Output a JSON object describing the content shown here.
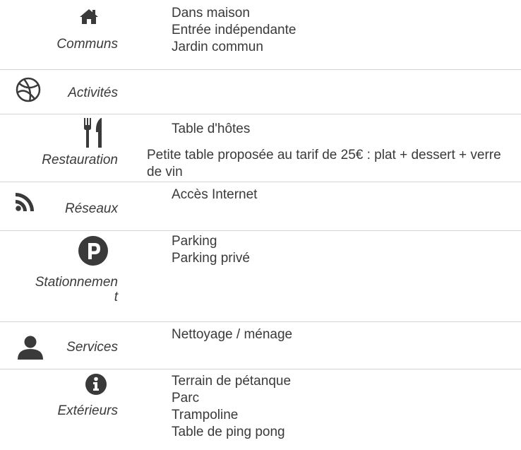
{
  "sections": [
    {
      "label": "Communs",
      "icon": "home-icon",
      "items": [
        "Dans maison",
        "Entrée indépendante",
        "Jardin commun"
      ]
    },
    {
      "label": "Activités",
      "icon": "basketball-icon",
      "items": []
    },
    {
      "label": "Restauration",
      "icon": "utensils-icon",
      "items": [
        "Table d'hôtes"
      ],
      "description": "Petite table proposée au tarif de 25€ : plat + dessert + verre de vin"
    },
    {
      "label": "Réseaux",
      "icon": "rss-icon",
      "items": [
        "Accès Internet"
      ]
    },
    {
      "label": "Stationnement",
      "icon": "parking-icon",
      "items": [
        "Parking",
        "Parking privé"
      ]
    },
    {
      "label": "Services",
      "icon": "user-icon",
      "items": [
        "Nettoyage / ménage"
      ]
    },
    {
      "label": "Extérieurs",
      "icon": "info-icon",
      "items": [
        "Terrain de pétanque",
        "Parc",
        "Trampoline",
        "Table de ping pong"
      ]
    }
  ]
}
